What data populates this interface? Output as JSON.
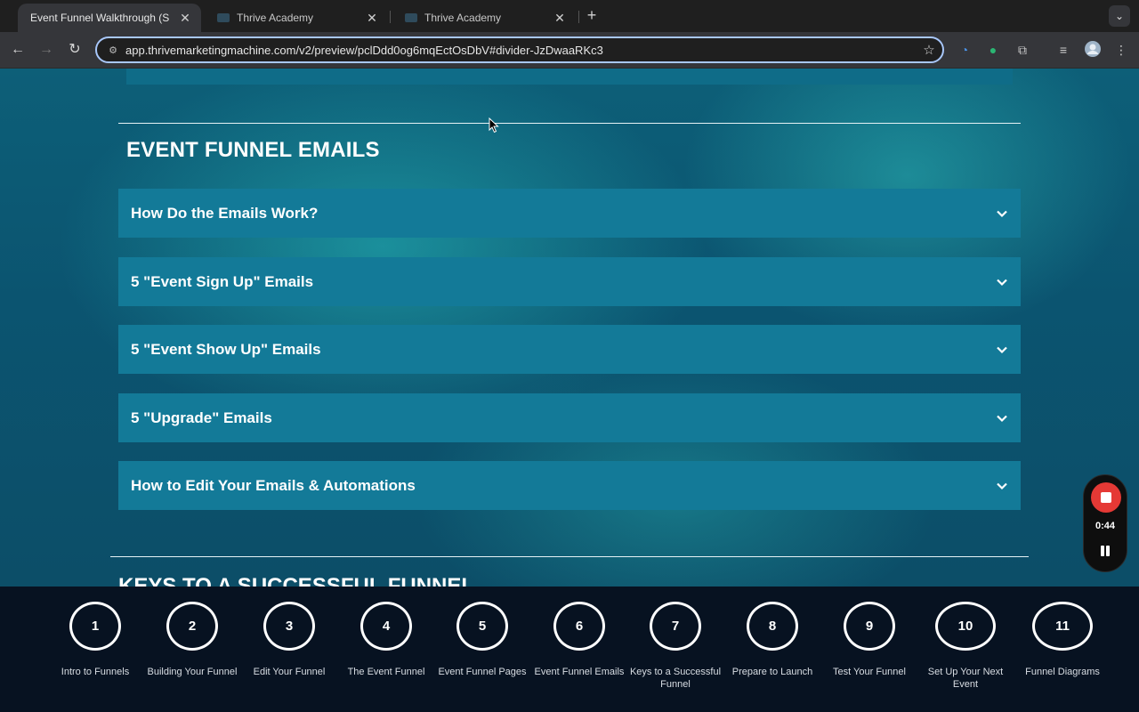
{
  "browser": {
    "tabs": [
      {
        "title": "Event Funnel Walkthrough (S",
        "active": true
      },
      {
        "title": "Thrive Academy",
        "active": false
      },
      {
        "title": "Thrive Academy",
        "active": false
      }
    ],
    "new_tab_symbol": "+",
    "url": "app.thrivemarketingmachine.com/v2/preview/pclDdd0og6mqEctOsDbV#divider-JzDwaaRKc3"
  },
  "section": {
    "title": "EVENT FUNNEL EMAILS",
    "accordions": [
      {
        "label": "How Do the Emails Work?"
      },
      {
        "label": "5 \"Event Sign Up\" Emails"
      },
      {
        "label": "5 \"Event Show Up\" Emails"
      },
      {
        "label": "5 \"Upgrade\" Emails"
      },
      {
        "label": "How to Edit Your Emails & Automations"
      }
    ]
  },
  "next_section_title": "KEYS TO A SUCCESSFUL FUNNEL",
  "recorder": {
    "time": "0:44"
  },
  "steps": [
    {
      "number": "1",
      "label": "Intro to Funnels"
    },
    {
      "number": "2",
      "label": "Building Your Funnel"
    },
    {
      "number": "3",
      "label": "Edit Your Funnel"
    },
    {
      "number": "4",
      "label": "The Event Funnel"
    },
    {
      "number": "5",
      "label": "Event Funnel Pages"
    },
    {
      "number": "6",
      "label": "Event Funnel Emails"
    },
    {
      "number": "7",
      "label": "Keys to a Successful Funnel"
    },
    {
      "number": "8",
      "label": "Prepare to Launch"
    },
    {
      "number": "9",
      "label": "Test Your Funnel"
    },
    {
      "number": "10",
      "label": "Set Up Your Next Event"
    },
    {
      "number": "11",
      "label": "Funnel Diagrams"
    }
  ],
  "colors": {
    "accent": "#137a98",
    "stepbar": "#071221",
    "record": "#e53935"
  }
}
